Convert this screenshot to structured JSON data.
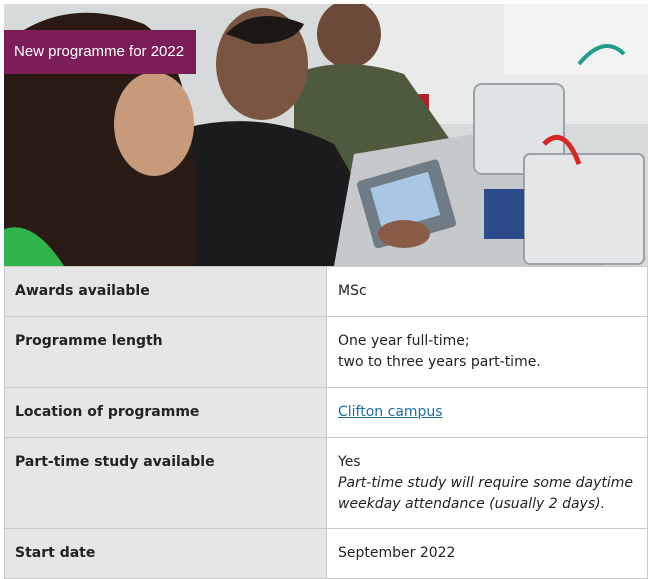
{
  "hero": {
    "badge_text": "New programme for 2022",
    "badge_color": "#7b1d56"
  },
  "programme_facts": [
    {
      "label": "Awards available",
      "value": "MSc"
    },
    {
      "label": "Programme length",
      "value_lines": [
        "One year full-time;",
        "two to three years part-time."
      ]
    },
    {
      "label": "Location of programme",
      "link_text": "Clifton campus"
    },
    {
      "label": "Part-time study available",
      "value": "Yes",
      "note": "Part-time study will require some daytime weekday attendance (usually 2 days)."
    },
    {
      "label": "Start date",
      "value": "September 2022"
    }
  ],
  "colors": {
    "label_cell_bg": "#e6e6e6",
    "border": "#c9c9c9",
    "link": "#1f6fa3"
  }
}
